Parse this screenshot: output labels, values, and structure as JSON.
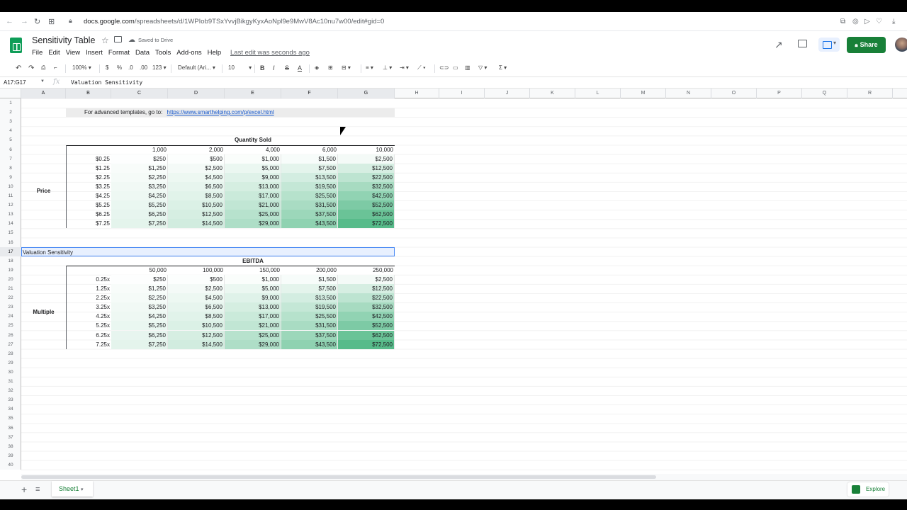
{
  "browser": {
    "url_host": "docs.google.com",
    "url_path": "/spreadsheets/d/1WPIob9TSxYvvjBikgyKyxAoNpl9e9MwV8Ac10nu7w00/edit#gid=0"
  },
  "doc": {
    "title": "Sensitivity Table",
    "saved": "Saved to Drive",
    "last_edit": "Last edit was seconds ago",
    "share_label": "Share"
  },
  "menu": [
    "File",
    "Edit",
    "View",
    "Insert",
    "Format",
    "Data",
    "Tools",
    "Add-ons",
    "Help"
  ],
  "toolbar": {
    "zoom": "100%",
    "currency": "$",
    "percent": "%",
    "dec_less": ".0",
    "dec_more": ".00",
    "more_formats": "123",
    "font": "Default (Ari...",
    "font_size": "10"
  },
  "formula_bar": {
    "name_box": "A17:G17",
    "fx": "fx",
    "value": "Valuation Sensitivity"
  },
  "columns": [
    "A",
    "B",
    "C",
    "D",
    "E",
    "F",
    "G",
    "H",
    "I",
    "J",
    "K",
    "L",
    "M",
    "N",
    "O",
    "P",
    "Q",
    "R"
  ],
  "banner": {
    "text": "For advanced templates, go to:",
    "link": "https://www.smarthelping.com/p/excel.html"
  },
  "table1": {
    "header": "Quantity Sold",
    "row_label": "Price",
    "cols": [
      "1,000",
      "2,000",
      "4,000",
      "6,000",
      "10,000"
    ],
    "rows": [
      "$0.25",
      "$1.25",
      "$2.25",
      "$3.25",
      "$4.25",
      "$5.25",
      "$6.25",
      "$7.25"
    ],
    "values": [
      [
        "$250",
        "$500",
        "$1,000",
        "$1,500",
        "$2,500"
      ],
      [
        "$1,250",
        "$2,500",
        "$5,000",
        "$7,500",
        "$12,500"
      ],
      [
        "$2,250",
        "$4,500",
        "$9,000",
        "$13,500",
        "$22,500"
      ],
      [
        "$3,250",
        "$6,500",
        "$13,000",
        "$19,500",
        "$32,500"
      ],
      [
        "$4,250",
        "$8,500",
        "$17,000",
        "$25,500",
        "$42,500"
      ],
      [
        "$5,250",
        "$10,500",
        "$21,000",
        "$31,500",
        "$52,500"
      ],
      [
        "$6,250",
        "$12,500",
        "$25,000",
        "$37,500",
        "$62,500"
      ],
      [
        "$7,250",
        "$14,500",
        "$29,000",
        "$43,500",
        "$72,500"
      ]
    ]
  },
  "section2_title": "Valuation Sensitivity",
  "table2": {
    "header": "EBITDA",
    "row_label": "Multiple",
    "cols": [
      "50,000",
      "100,000",
      "150,000",
      "200,000",
      "250,000"
    ],
    "rows": [
      "0.25x",
      "1.25x",
      "2.25x",
      "3.25x",
      "4.25x",
      "5.25x",
      "6.25x",
      "7.25x"
    ],
    "values": [
      [
        "$250",
        "$500",
        "$1,000",
        "$1,500",
        "$2,500"
      ],
      [
        "$1,250",
        "$2,500",
        "$5,000",
        "$7,500",
        "$12,500"
      ],
      [
        "$2,250",
        "$4,500",
        "$9,000",
        "$13,500",
        "$22,500"
      ],
      [
        "$3,250",
        "$6,500",
        "$13,000",
        "$19,500",
        "$32,500"
      ],
      [
        "$4,250",
        "$8,500",
        "$17,000",
        "$25,500",
        "$42,500"
      ],
      [
        "$5,250",
        "$10,500",
        "$21,000",
        "$31,500",
        "$52,500"
      ],
      [
        "$6,250",
        "$12,500",
        "$25,000",
        "$37,500",
        "$62,500"
      ],
      [
        "$7,250",
        "$14,500",
        "$29,000",
        "$43,500",
        "$72,500"
      ]
    ]
  },
  "heat": {
    "low": "#ffffff",
    "high": "#57bb8a"
  },
  "sheet_tab": "Sheet1",
  "explore_label": "Explore"
}
